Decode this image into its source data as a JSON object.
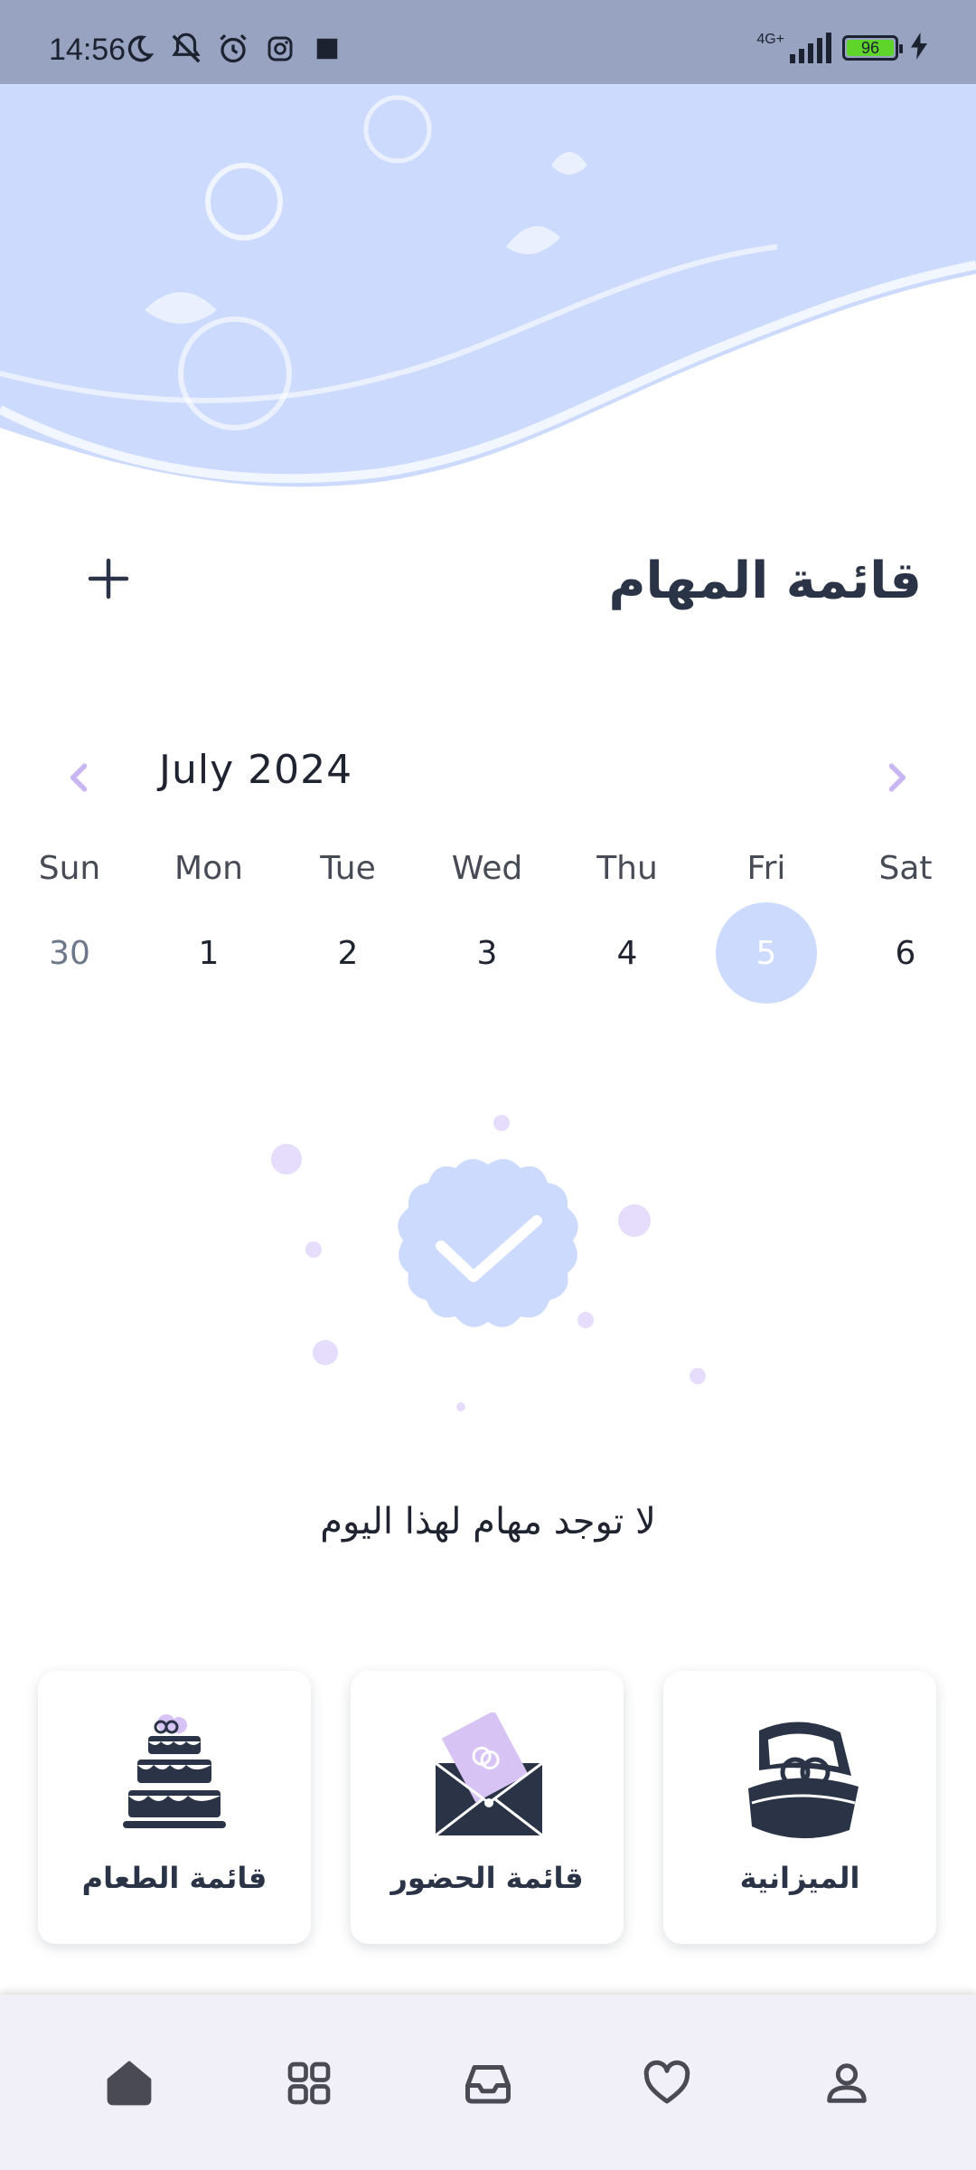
{
  "status_bar": {
    "time": "14:56",
    "network": "4G+",
    "battery_level": "96",
    "left_icons": [
      "moon-icon",
      "vibrate-off-icon",
      "alarm-icon",
      "instagram-icon",
      "square-icon"
    ],
    "right_icons": [
      "signal-icon",
      "battery-icon",
      "charging-icon"
    ]
  },
  "header": {
    "title": "قائمة المهام",
    "add_icon": "plus-icon"
  },
  "calendar": {
    "month_label": "July 2024",
    "prev_icon": "chevron-left-icon",
    "next_icon": "chevron-right-icon",
    "weekdays": [
      "Sun",
      "Mon",
      "Tue",
      "Wed",
      "Thu",
      "Fri",
      "Sat"
    ],
    "days": [
      "30",
      "1",
      "2",
      "3",
      "4",
      "5",
      "6"
    ],
    "selected_day": "5",
    "selected_color": "#ccdafd",
    "chevron_color": "#c9b6f2"
  },
  "empty_state": {
    "message": "لا توجد مهام لهذا اليوم",
    "icon": "check-badge-icon"
  },
  "cards": [
    {
      "label": "قائمة الطعام",
      "icon": "cake-icon"
    },
    {
      "label": "قائمة الحضور",
      "icon": "invitation-envelope-icon"
    },
    {
      "label": "الميزانية",
      "icon": "ring-box-icon"
    }
  ],
  "bottom_nav": {
    "items": [
      "home-icon",
      "grid-icon",
      "inbox-icon",
      "heart-icon",
      "profile-icon"
    ],
    "active": "home-icon"
  },
  "colors": {
    "status_bar": "#97a3c0",
    "header_bg": "#ccdafd",
    "text_dark": "#2b3446",
    "nav_bg": "#f1eff7"
  }
}
